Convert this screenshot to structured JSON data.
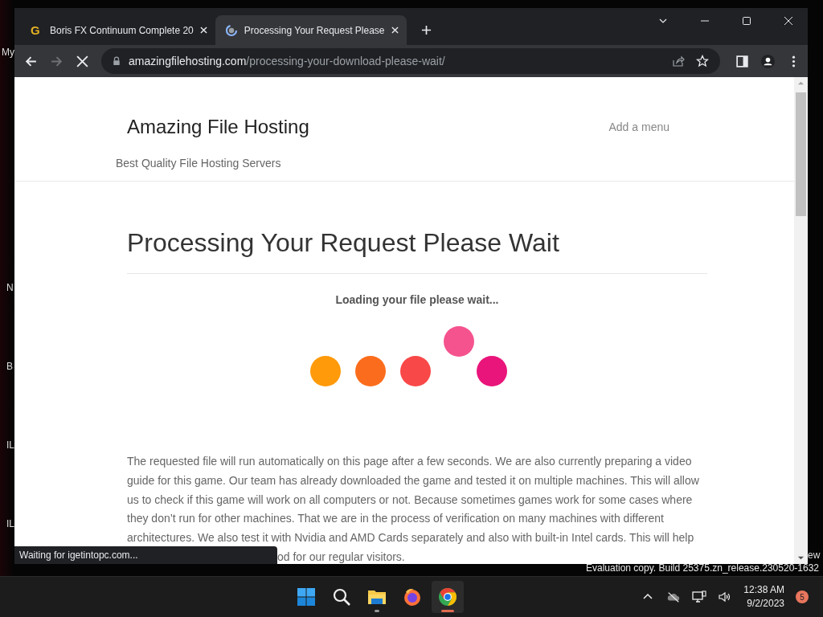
{
  "desktop_labels": [
    "My",
    "N",
    "B",
    "IL",
    "IL",
    "ew"
  ],
  "browser": {
    "tabs": [
      {
        "title": "Boris FX Continuum Complete 20",
        "selected": false,
        "kind": "letter",
        "favicon": "G"
      },
      {
        "title": "Processing Your Request Please",
        "selected": true,
        "kind": "spinner"
      }
    ],
    "loading": true,
    "address": {
      "domain": "amazingfilehosting.com",
      "path": "/processing-your-download-please-wait/"
    },
    "status_bubble": "Waiting for igetintopc.com..."
  },
  "page": {
    "site_title": "Amazing File Hosting",
    "menu_link": "Add a menu",
    "tagline": "Best Quality File Hosting Servers",
    "heading": "Processing Your Request Please Wait",
    "loading_text": "Loading your file please wait...",
    "paragraph": "The requested file will run automatically on this page after a few seconds. We are also currently preparing a video guide for this game. Our team has already downloaded the game and tested it on multiple machines. This will allow us to check if this game will work on all computers or not. Because sometimes games work for some cases where they don’t run for other machines. That we are in the process of verification on many machines with different architectures. We also test it with Nvidia and AMD Cards separately and also with built-in Intel cards. This will help",
    "paragraph_tail": "od for our regular visitors."
  },
  "watermark": "Evaluation copy. Build 25375.zn_release.230520-1632",
  "taskbar": {
    "apps": [
      {
        "kind": "start",
        "active": false
      },
      {
        "kind": "search",
        "active": false
      },
      {
        "kind": "explorer",
        "active": false,
        "running": true
      },
      {
        "kind": "firefox",
        "active": false,
        "running": false
      },
      {
        "kind": "chrome",
        "active": true,
        "running": true
      }
    ],
    "time": "12:38 AM",
    "date": "9/2/2023",
    "notifications": "5"
  }
}
